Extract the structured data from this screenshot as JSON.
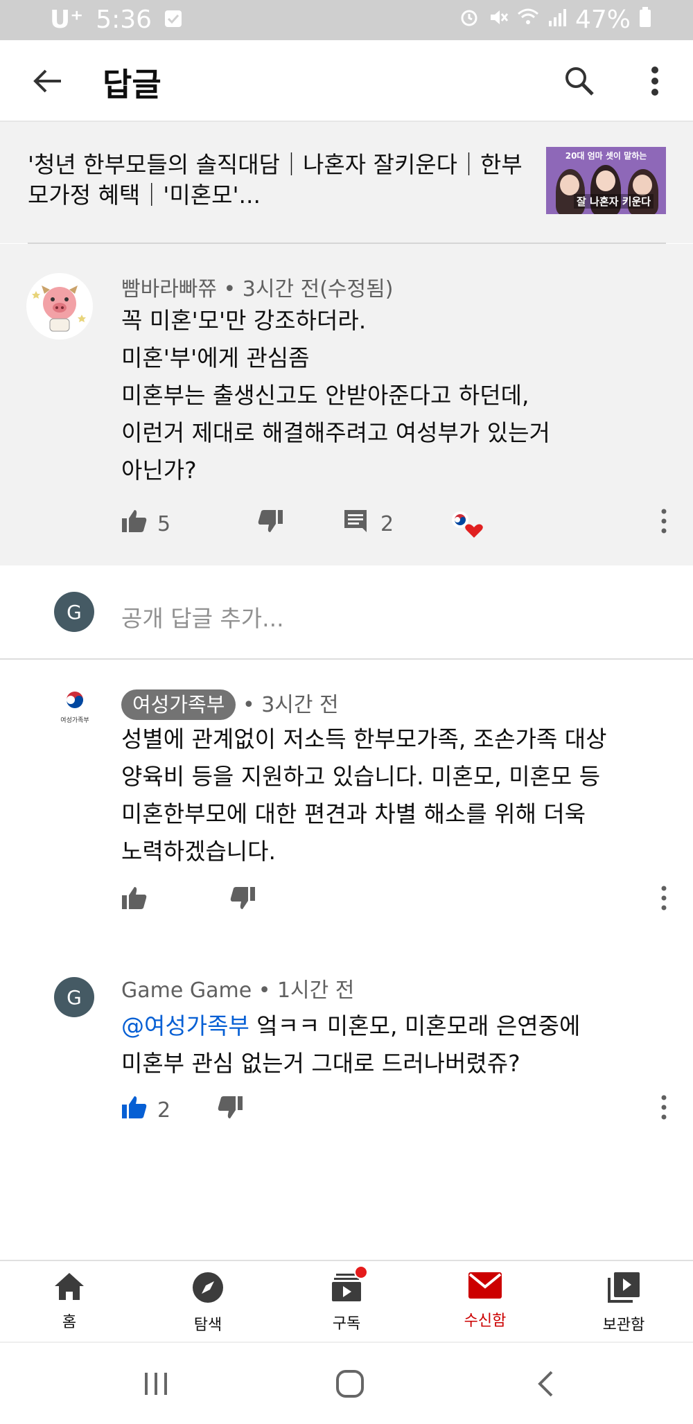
{
  "status_bar": {
    "carrier": "U⁺",
    "time": "5:36",
    "battery": "47%"
  },
  "app_bar": {
    "title": "답글",
    "icons": [
      "back-arrow-icon",
      "search-icon",
      "more-vert-icon"
    ]
  },
  "video": {
    "title": "'청년 한부모들의 솔직대담｜나혼자 잘키운다｜한부모가정 혜택｜'미혼모'...",
    "thumbnail_text": "20대 엄마 셋이 말하는",
    "thumbnail_big_text": "잘 나혼자 키운다"
  },
  "main_comment": {
    "author": "빰바라빠쮸",
    "time": "3시간 전(수정됨)",
    "lines": [
      "꼭 미혼'모'만 강조하더라.",
      "미혼'부'에게 관심좀",
      "미혼부는 출생신고도 안받아준다고 하던데,",
      "이런거 제대로 해결해주려고 여성부가 있는거",
      "아닌가?"
    ],
    "likes": "5",
    "replies": "2"
  },
  "reply_input": {
    "avatar_letter": "G",
    "placeholder": "공개 답글 추가..."
  },
  "replies": [
    {
      "author": "여성가족부",
      "logo_text": "여성가족부",
      "time": "3시간 전",
      "lines": [
        "성별에 관계없이 저소득 한부모가족, 조손가족 대상",
        "양육비 등을 지원하고 있습니다. 미혼모, 미혼모 등",
        "미혼한부모에 대한 편견과 차별 해소를 위해 더욱",
        "노력하겠습니다."
      ]
    },
    {
      "author": "Game Game",
      "avatar_letter": "G",
      "time": "1시간 전",
      "mention": "@여성가족부",
      "line1_rest": " 엌ㅋㅋ 미혼모, 미혼모래 은연중에",
      "line2": "미혼부 관심 없는거 그대로 드러나버렸쥬?",
      "likes": "2"
    }
  ],
  "bottom_nav": [
    {
      "label": "홈",
      "icon": "home-icon"
    },
    {
      "label": "탐색",
      "icon": "explore-icon"
    },
    {
      "label": "구독",
      "icon": "subscriptions-icon"
    },
    {
      "label": "수신함",
      "icon": "inbox-icon"
    },
    {
      "label": "보관함",
      "icon": "library-icon"
    }
  ],
  "colors": {
    "accent_red": "#cc0000",
    "link_blue": "#065fd4",
    "like_active": "#065fd4"
  }
}
